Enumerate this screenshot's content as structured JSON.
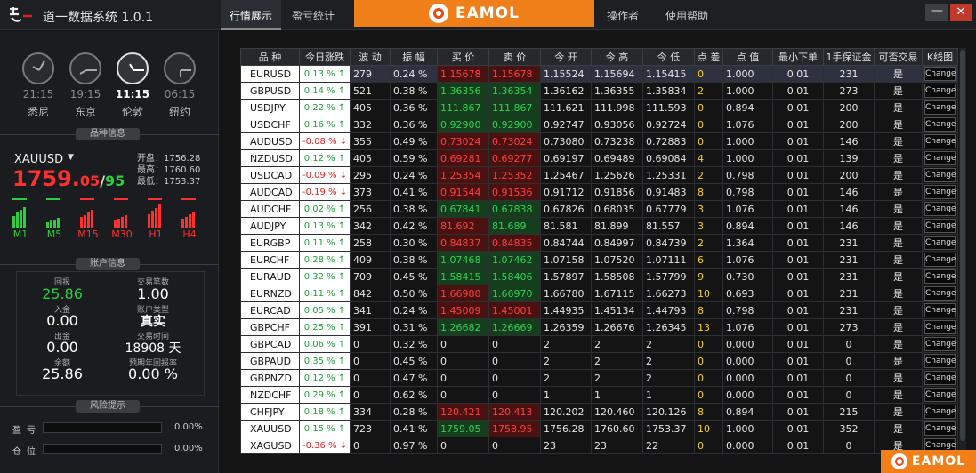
{
  "app": {
    "title": "道一数据系统 1.0.1"
  },
  "tabs": [
    {
      "label": "行情展示",
      "active": true
    },
    {
      "label": "盈亏统计",
      "active": false
    },
    {
      "label": "操作者",
      "active": false
    },
    {
      "label": "使用帮助",
      "active": false
    }
  ],
  "banner": {
    "brand": "EAMOL"
  },
  "window": {
    "minimize": "—",
    "close": "✕"
  },
  "clocks": [
    {
      "time": "21:15",
      "city": "悉尼",
      "active": false
    },
    {
      "time": "19:15",
      "city": "东京",
      "active": false
    },
    {
      "time": "11:15",
      "city": "伦敦",
      "active": true
    },
    {
      "time": "06:15",
      "city": "纽约",
      "active": false
    }
  ],
  "symbol_info": {
    "section": "品种信息",
    "symbol": "XAUUSD",
    "dropdown": "▼",
    "price_int": "1759.",
    "price_frac": "05",
    "price_sep": "/",
    "price_ask": "95",
    "open_label": "开盘：",
    "open": "1756.28",
    "high_label": "最高：",
    "high": "1760.60",
    "low_label": "最低：",
    "low": "1753.37"
  },
  "timeframes": [
    {
      "label": "M1",
      "color": "#2ecc40",
      "level": 0.8
    },
    {
      "label": "M5",
      "color": "#2ecc40",
      "level": 0.4
    },
    {
      "label": "M15",
      "color": "#ff3030",
      "level": 0.7
    },
    {
      "label": "M30",
      "color": "#ff3030",
      "level": 0.5
    },
    {
      "label": "H1",
      "color": "#ff3030",
      "level": 0.9
    },
    {
      "label": "H4",
      "color": "#ff3030",
      "level": 0.6
    }
  ],
  "account": {
    "section": "账户信息",
    "items": [
      {
        "label": "回报",
        "value": "25.86",
        "color": "#2ecc40"
      },
      {
        "label": "交易笔数",
        "value": "1.00",
        "color": "#ffffff"
      },
      {
        "label": "入金",
        "value": "0.00",
        "color": "#ffffff"
      },
      {
        "label": "账户类型",
        "value": "真实",
        "color": "#ffffff"
      },
      {
        "label": "出金",
        "value": "0.00",
        "color": "#ffffff"
      },
      {
        "label": "交易时间",
        "value": "18908 天",
        "color": "#ffffff"
      },
      {
        "label": "余额",
        "value": "25.86",
        "color": "#ffffff"
      },
      {
        "label": "预期年回报率",
        "value": "0.00 %",
        "color": "#ffffff"
      }
    ]
  },
  "risk": {
    "section": "风险提示",
    "items": [
      {
        "label": "盈亏",
        "pct": "0.00%"
      },
      {
        "label": "仓位",
        "pct": "0.00%"
      }
    ]
  },
  "table": {
    "headers": [
      "品 种",
      "今日涨跌",
      "波 动",
      "振 幅",
      "买 价",
      "卖 价",
      "今 开",
      "今 高",
      "今 低",
      "点 差",
      "点 值",
      "最小下单",
      "1手保证金",
      "可否交易",
      "K线图"
    ],
    "change_label": "Change",
    "rows": [
      {
        "sym": "EURUSD",
        "chg": "0.13 % ↑",
        "dir": "up",
        "vol": "279",
        "amp": "0.24 %",
        "bid": "1.15678",
        "ask": "1.15678",
        "bd": "down",
        "open": "1.15524",
        "high": "1.15694",
        "low": "1.15415",
        "spread": "0",
        "pv": "1.000",
        "min": "0.01",
        "margin": "231",
        "trade": "是"
      },
      {
        "sym": "GBPUSD",
        "chg": "0.14 % ↑",
        "dir": "up",
        "vol": "521",
        "amp": "0.38 %",
        "bid": "1.36356",
        "ask": "1.36354",
        "bd": "up",
        "open": "1.36162",
        "high": "1.36355",
        "low": "1.35834",
        "spread": "2",
        "pv": "1.000",
        "min": "0.01",
        "margin": "273",
        "trade": "是"
      },
      {
        "sym": "USDJPY",
        "chg": "0.22 % ↑",
        "dir": "up",
        "vol": "405",
        "amp": "0.36 %",
        "bid": "111.867",
        "ask": "111.867",
        "bd": "up",
        "open": "111.621",
        "high": "111.998",
        "low": "111.593",
        "spread": "0",
        "pv": "0.894",
        "min": "0.01",
        "margin": "200",
        "trade": "是"
      },
      {
        "sym": "USDCHF",
        "chg": "0.16 % ↑",
        "dir": "up",
        "vol": "332",
        "amp": "0.36 %",
        "bid": "0.92900",
        "ask": "0.92900",
        "bd": "up",
        "open": "0.92747",
        "high": "0.93056",
        "low": "0.92724",
        "spread": "0",
        "pv": "1.076",
        "min": "0.01",
        "margin": "200",
        "trade": "是"
      },
      {
        "sym": "AUDUSD",
        "chg": "-0.08 % ↓",
        "dir": "down",
        "vol": "355",
        "amp": "0.49 %",
        "bid": "0.73024",
        "ask": "0.73024",
        "bd": "down",
        "open": "0.73080",
        "high": "0.73238",
        "low": "0.72883",
        "spread": "0",
        "pv": "1.000",
        "min": "0.01",
        "margin": "146",
        "trade": "是"
      },
      {
        "sym": "NZDUSD",
        "chg": "0.12 % ↑",
        "dir": "up",
        "vol": "405",
        "amp": "0.59 %",
        "bid": "0.69281",
        "ask": "0.69277",
        "bd": "down",
        "open": "0.69197",
        "high": "0.69489",
        "low": "0.69084",
        "spread": "4",
        "pv": "1.000",
        "min": "0.01",
        "margin": "139",
        "trade": "是"
      },
      {
        "sym": "USDCAD",
        "chg": "-0.09 % ↓",
        "dir": "down",
        "vol": "295",
        "amp": "0.24 %",
        "bid": "1.25354",
        "ask": "1.25352",
        "bd": "down",
        "open": "1.25467",
        "high": "1.25626",
        "low": "1.25331",
        "spread": "2",
        "pv": "0.798",
        "min": "0.01",
        "margin": "200",
        "trade": "是"
      },
      {
        "sym": "AUDCAD",
        "chg": "-0.19 % ↓",
        "dir": "down",
        "vol": "373",
        "amp": "0.41 %",
        "bid": "0.91544",
        "ask": "0.91536",
        "bd": "down",
        "open": "0.91712",
        "high": "0.91856",
        "low": "0.91483",
        "spread": "8",
        "pv": "0.798",
        "min": "0.01",
        "margin": "146",
        "trade": "是"
      },
      {
        "sym": "AUDCHF",
        "chg": "0.02 % ↑",
        "dir": "up",
        "vol": "256",
        "amp": "0.38 %",
        "bid": "0.67841",
        "ask": "0.67838",
        "bd": "up",
        "open": "0.67826",
        "high": "0.68035",
        "low": "0.67779",
        "spread": "3",
        "pv": "1.076",
        "min": "0.01",
        "margin": "146",
        "trade": "是"
      },
      {
        "sym": "AUDJPY",
        "chg": "0.13 % ↑",
        "dir": "up",
        "vol": "342",
        "amp": "0.42 %",
        "bid": "81.692",
        "ask": "81.689",
        "bd": "mixed",
        "open": "81.581",
        "high": "81.899",
        "low": "81.557",
        "spread": "3",
        "pv": "0.894",
        "min": "0.01",
        "margin": "146",
        "trade": "是"
      },
      {
        "sym": "EURGBP",
        "chg": "0.11 % ↑",
        "dir": "up",
        "vol": "258",
        "amp": "0.30 %",
        "bid": "0.84837",
        "ask": "0.84835",
        "bd": "down",
        "open": "0.84744",
        "high": "0.84997",
        "low": "0.84739",
        "spread": "2",
        "pv": "1.364",
        "min": "0.01",
        "margin": "231",
        "trade": "是"
      },
      {
        "sym": "EURCHF",
        "chg": "0.28 % ↑",
        "dir": "up",
        "vol": "409",
        "amp": "0.38 %",
        "bid": "1.07468",
        "ask": "1.07462",
        "bd": "up",
        "open": "1.07158",
        "high": "1.07520",
        "low": "1.07111",
        "spread": "6",
        "pv": "1.076",
        "min": "0.01",
        "margin": "231",
        "trade": "是"
      },
      {
        "sym": "EURAUD",
        "chg": "0.32 % ↑",
        "dir": "up",
        "vol": "709",
        "amp": "0.45 %",
        "bid": "1.58415",
        "ask": "1.58406",
        "bd": "up",
        "open": "1.57897",
        "high": "1.58508",
        "low": "1.57799",
        "spread": "9",
        "pv": "0.730",
        "min": "0.01",
        "margin": "231",
        "trade": "是"
      },
      {
        "sym": "EURNZD",
        "chg": "0.11 % ↑",
        "dir": "up",
        "vol": "842",
        "amp": "0.50 %",
        "bid": "1.66980",
        "ask": "1.66970",
        "bd": "mixed2",
        "open": "1.66780",
        "high": "1.67115",
        "low": "1.66273",
        "spread": "10",
        "pv": "0.693",
        "min": "0.01",
        "margin": "231",
        "trade": "是"
      },
      {
        "sym": "EURCAD",
        "chg": "0.05 % ↑",
        "dir": "up",
        "vol": "341",
        "amp": "0.24 %",
        "bid": "1.45009",
        "ask": "1.45001",
        "bd": "down",
        "open": "1.44935",
        "high": "1.45134",
        "low": "1.44793",
        "spread": "8",
        "pv": "0.798",
        "min": "0.01",
        "margin": "231",
        "trade": "是"
      },
      {
        "sym": "GBPCHF",
        "chg": "0.25 % ↑",
        "dir": "up",
        "vol": "391",
        "amp": "0.31 %",
        "bid": "1.26682",
        "ask": "1.26669",
        "bd": "up",
        "open": "1.26359",
        "high": "1.26676",
        "low": "1.26345",
        "spread": "13",
        "pv": "1.076",
        "min": "0.01",
        "margin": "273",
        "trade": "是"
      },
      {
        "sym": "GBPCAD",
        "chg": "0.06 % ↑",
        "dir": "up",
        "vol": "0",
        "amp": "0.32 %",
        "bid": "0",
        "ask": "0",
        "bd": "none",
        "open": "2",
        "high": "2",
        "low": "2",
        "spread": "0",
        "pv": "0.000",
        "min": "0.01",
        "margin": "0",
        "trade": "是"
      },
      {
        "sym": "GBPAUD",
        "chg": "0.35 % ↑",
        "dir": "up",
        "vol": "0",
        "amp": "0.45 %",
        "bid": "0",
        "ask": "0",
        "bd": "none",
        "open": "2",
        "high": "2",
        "low": "2",
        "spread": "0",
        "pv": "0.000",
        "min": "0.01",
        "margin": "0",
        "trade": "是"
      },
      {
        "sym": "GBPNZD",
        "chg": "0.12 % ↑",
        "dir": "up",
        "vol": "0",
        "amp": "0.47 %",
        "bid": "0",
        "ask": "0",
        "bd": "none",
        "open": "2",
        "high": "2",
        "low": "2",
        "spread": "0",
        "pv": "0.000",
        "min": "0.01",
        "margin": "0",
        "trade": "是"
      },
      {
        "sym": "NZDCHF",
        "chg": "0.29 % ↑",
        "dir": "up",
        "vol": "0",
        "amp": "0.62 %",
        "bid": "0",
        "ask": "0",
        "bd": "none",
        "open": "1",
        "high": "1",
        "low": "1",
        "spread": "0",
        "pv": "0.000",
        "min": "0.01",
        "margin": "0",
        "trade": "是"
      },
      {
        "sym": "CHFJPY",
        "chg": "0.18 % ↑",
        "dir": "up",
        "vol": "334",
        "amp": "0.28 %",
        "bid": "120.421",
        "ask": "120.413",
        "bd": "down",
        "open": "120.202",
        "high": "120.460",
        "low": "120.126",
        "spread": "8",
        "pv": "0.894",
        "min": "0.01",
        "margin": "215",
        "trade": "是"
      },
      {
        "sym": "XAUUSD",
        "chg": "0.15 % ↑",
        "dir": "up",
        "vol": "723",
        "amp": "0.41 %",
        "bid": "1759.05",
        "ask": "1758.95",
        "bd": "mixed3",
        "open": "1756.28",
        "high": "1760.60",
        "low": "1753.37",
        "spread": "10",
        "pv": "1.000",
        "min": "0.01",
        "margin": "352",
        "trade": "是"
      },
      {
        "sym": "XAGUSD",
        "chg": "-0.36 % ↓",
        "dir": "down",
        "vol": "0",
        "amp": "0.97 %",
        "bid": "0",
        "ask": "0",
        "bd": "none",
        "open": "23",
        "high": "23",
        "low": "22",
        "spread": "0",
        "pv": "0.000",
        "min": "0.01",
        "margin": "0",
        "trade": "是"
      }
    ]
  }
}
